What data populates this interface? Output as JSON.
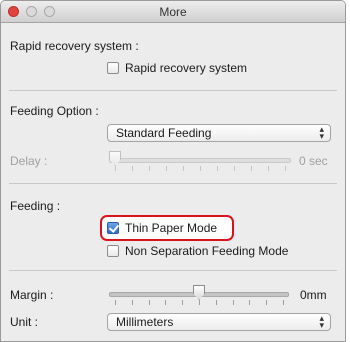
{
  "window": {
    "title": "More"
  },
  "rapid": {
    "label": "Rapid recovery system :",
    "checkbox_label": "Rapid recovery system",
    "checked": false
  },
  "feeding_option": {
    "label": "Feeding Option :",
    "selected": "Standard Feeding",
    "delay_label": "Delay :",
    "delay_value": "0 sec",
    "delay_fraction": 0
  },
  "feeding": {
    "label": "Feeding :",
    "thin_paper_label": "Thin Paper Mode",
    "thin_paper_checked": true,
    "non_sep_label": "Non Separation Feeding Mode",
    "non_sep_checked": false
  },
  "margin": {
    "label": "Margin :",
    "value": "0mm",
    "fraction": 0.5
  },
  "unit": {
    "label": "Unit :",
    "selected": "Millimeters"
  },
  "colors": {
    "highlight": "#d8141a",
    "checkbox_checked": "#2f6dc7",
    "close_button": "#e0443e"
  },
  "icons": {
    "select_arrows": "up-down-arrows-icon",
    "close": "close-icon",
    "minimize": "minimize-icon",
    "zoom": "zoom-icon"
  }
}
